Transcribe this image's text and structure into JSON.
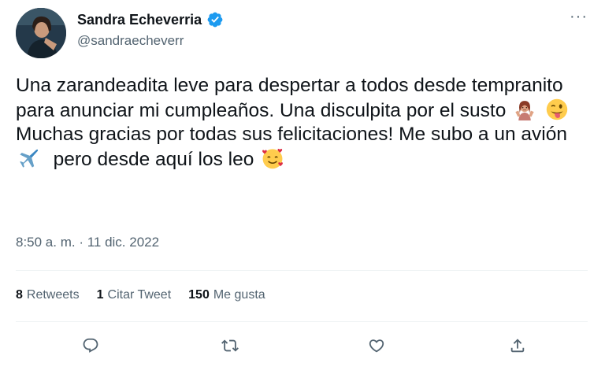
{
  "user": {
    "name": "Sandra Echeverria",
    "handle": "@sandraecheverr"
  },
  "icons": {
    "verified": "verified-badge-icon",
    "more": "more-options-icon",
    "reply": "reply-icon",
    "retweet": "retweet-icon",
    "like": "like-icon",
    "share": "share-icon"
  },
  "colors": {
    "verified": "#1d9bf0",
    "text": "#0f1419",
    "secondary": "#536471",
    "divider": "#eff3f4"
  },
  "tweet": {
    "part1": "Una zarandeadita leve para despertar a todos desde tempranito para anunciar mi cumpleaños. Una disculpita por el susto",
    "part2": "Muchas gracias por todas sus felicitaciones! Me subo a un avión",
    "part3": "pero desde aquí los leo",
    "more_label": "···"
  },
  "timestamp": "8:50 a. m. · 11 dic. 2022",
  "stats": {
    "retweets_count": "8",
    "retweets_label": "Retweets",
    "quotes_count": "1",
    "quotes_label": "Citar Tweet",
    "likes_count": "150",
    "likes_label": "Me gusta"
  }
}
